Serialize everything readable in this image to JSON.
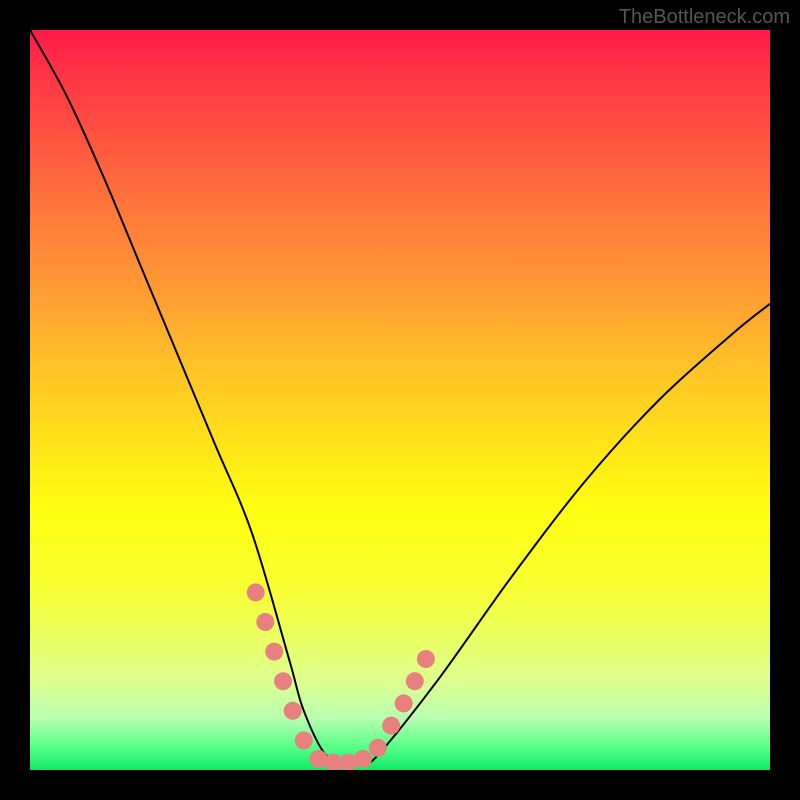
{
  "watermark": "TheBottleneck.com",
  "chart_data": {
    "type": "line",
    "title": "",
    "xlabel": "",
    "ylabel": "",
    "xlim": [
      0,
      100
    ],
    "ylim": [
      0,
      100
    ],
    "series": [
      {
        "name": "bottleneck-curve",
        "x": [
          0,
          5,
          10,
          15,
          20,
          25,
          30,
          35,
          37,
          40,
          43,
          45,
          47,
          55,
          65,
          75,
          85,
          95,
          100
        ],
        "values": [
          100,
          91,
          80,
          68,
          56,
          44,
          32,
          15,
          8,
          2,
          1,
          1,
          2,
          12,
          26,
          39,
          50,
          59,
          63
        ]
      }
    ],
    "markers": {
      "name": "highlight-dots",
      "color": "#e88080",
      "radius": 9,
      "points": [
        {
          "x": 30.5,
          "y": 24
        },
        {
          "x": 31.8,
          "y": 20
        },
        {
          "x": 33.0,
          "y": 16
        },
        {
          "x": 34.2,
          "y": 12
        },
        {
          "x": 35.5,
          "y": 8
        },
        {
          "x": 37.0,
          "y": 4
        },
        {
          "x": 39.0,
          "y": 1.5
        },
        {
          "x": 41.0,
          "y": 1
        },
        {
          "x": 43.0,
          "y": 1
        },
        {
          "x": 45.0,
          "y": 1.5
        },
        {
          "x": 47.0,
          "y": 3
        },
        {
          "x": 48.8,
          "y": 6
        },
        {
          "x": 50.5,
          "y": 9
        },
        {
          "x": 52.0,
          "y": 12
        },
        {
          "x": 53.5,
          "y": 15
        }
      ]
    }
  }
}
